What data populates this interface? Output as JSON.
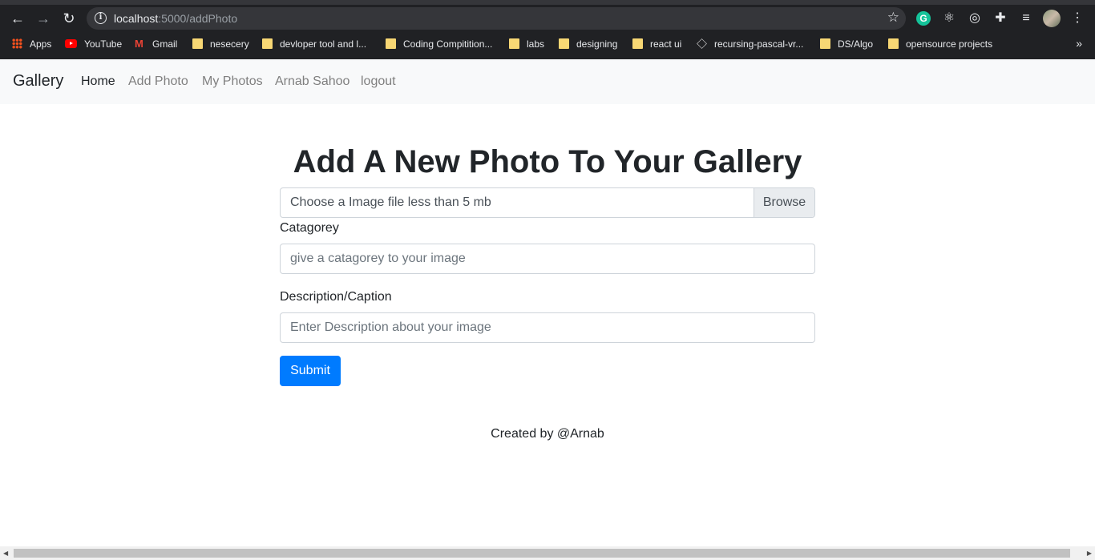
{
  "browser": {
    "url_host": "localhost",
    "url_path": ":5000/addPhoto",
    "back_icon": "back-arrow-icon",
    "forward_icon": "forward-arrow-icon",
    "reload_icon": "reload-icon",
    "bookmarks": [
      {
        "label": "Apps",
        "icon": "apps-grid-icon"
      },
      {
        "label": "YouTube",
        "icon": "youtube-icon"
      },
      {
        "label": "Gmail",
        "icon": "gmail-icon"
      },
      {
        "label": "nesecery",
        "icon": "folder-icon"
      },
      {
        "label": "devloper tool and l...",
        "icon": "folder-icon"
      },
      {
        "label": "Coding Compitition...",
        "icon": "folder-icon"
      },
      {
        "label": "labs",
        "icon": "folder-icon"
      },
      {
        "label": "designing",
        "icon": "folder-icon"
      },
      {
        "label": "react ui",
        "icon": "folder-icon"
      },
      {
        "label": "recursing-pascal-vr...",
        "icon": "cube-icon"
      },
      {
        "label": "DS/Algo",
        "icon": "folder-icon"
      },
      {
        "label": "opensource projects",
        "icon": "folder-icon"
      }
    ],
    "more_bookmarks": "»"
  },
  "navbar": {
    "brand": "Gallery",
    "links": [
      "Home",
      "Add Photo",
      "My Photos",
      "Arnab Sahoo",
      "logout"
    ]
  },
  "form": {
    "title": "Add A New Photo To Your Gallery",
    "file_label": "Choose a Image file less than 5 mb",
    "browse_label": "Browse",
    "category_label": "Catagorey",
    "category_placeholder": "give a catagorey to your image",
    "description_label": "Description/Caption",
    "description_placeholder": "Enter Description about your image",
    "submit_label": "Submit"
  },
  "footer": {
    "text": "Created by @Arnab"
  },
  "colors": {
    "primary": "#007bff",
    "navbar_bg": "#f8f9fa",
    "chrome_bg": "#202124"
  }
}
